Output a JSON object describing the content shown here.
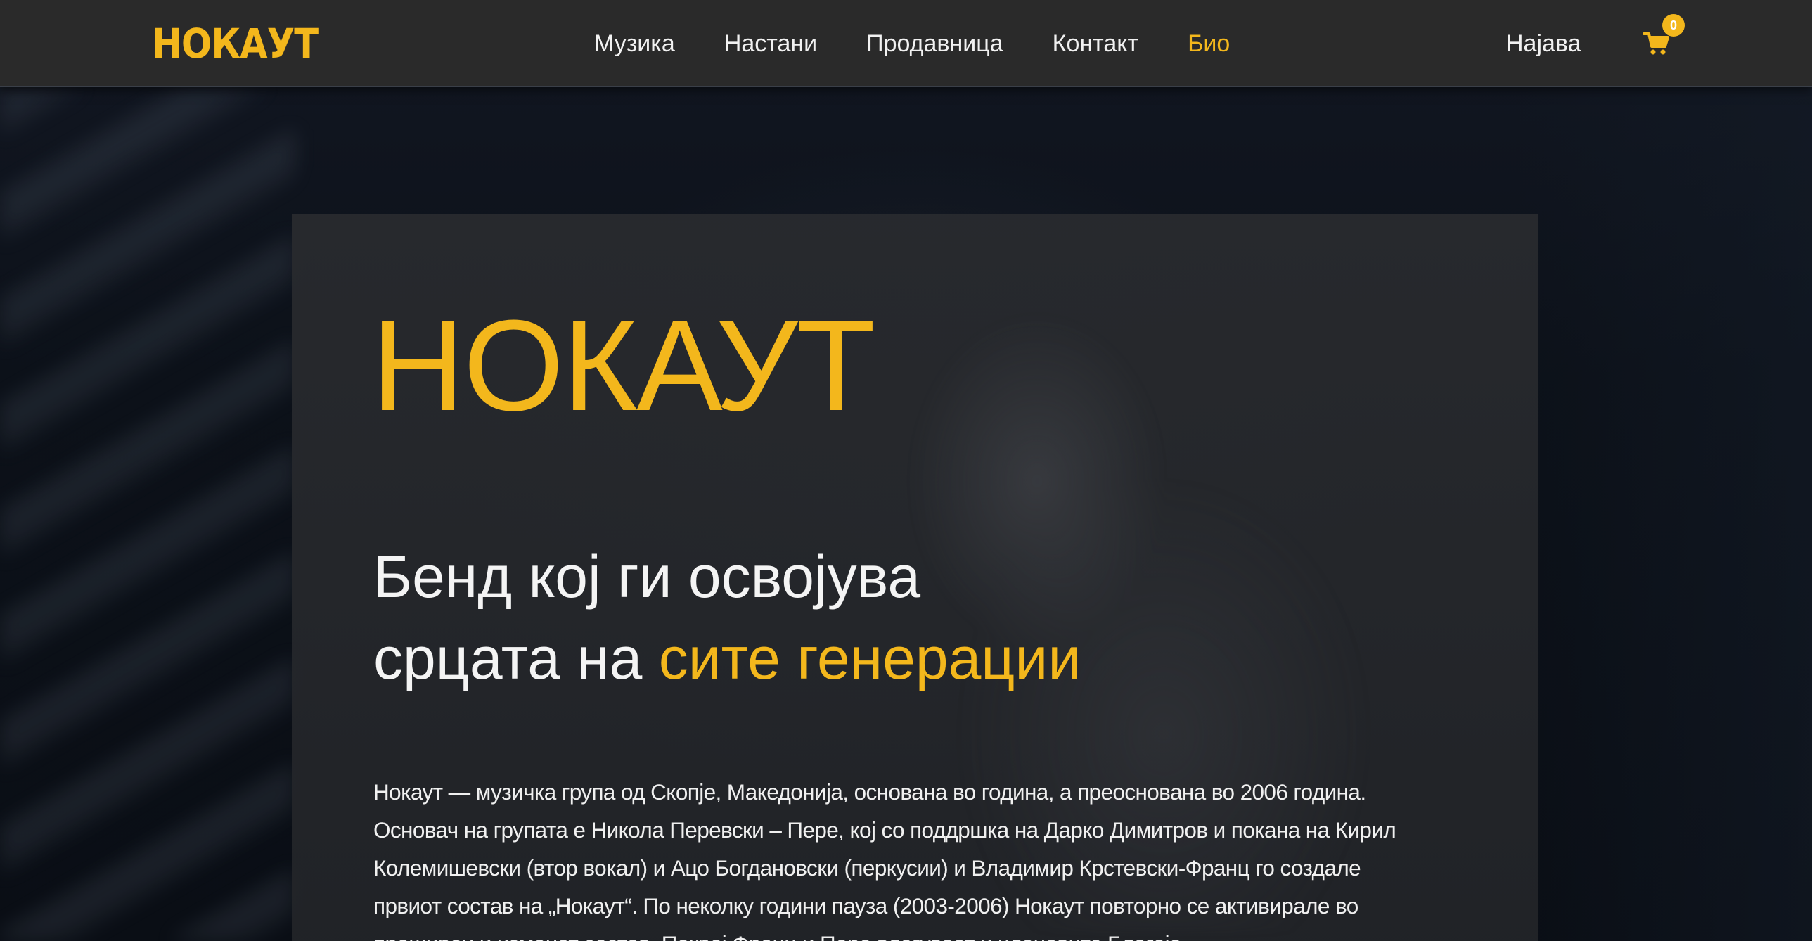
{
  "header": {
    "logo_text": "НОКАУТ",
    "nav": [
      {
        "label": "Музика"
      },
      {
        "label": "Настани"
      },
      {
        "label": "Продавница"
      },
      {
        "label": "Контакт"
      },
      {
        "label": "Био"
      }
    ],
    "active_nav": "Био",
    "login_label": "Најава",
    "cart_count": "0"
  },
  "hero": {
    "title": "НОКАУТ",
    "tagline_line1": "Бенд кој ги освојува",
    "tagline_line2_start": "срцата на ",
    "tagline_line2_accent": "сите генерации"
  },
  "bio": {
    "lines": [
      "Нокаут — музичка група од Скопје, Македонија, основана во   година, а преоснована во 2006 година.",
      "Основач на групата е Никола Перевски – Пере, кој со поддршка на Дарко Димитров и покана на Кирил",
      "Колемишевски (втор вокал) и Ацо Богдановски (перкусии) и Владимир Крстевски-Франц го создале",
      "првиот состав на „Нокаут“. По неколку години пауза (2003-2006) Нокаут повторно се активирале во",
      "проширен и изменет состав. Покрај Франц и Пере влегуваат и членовите Благоја"
    ]
  },
  "colors": {
    "accent": "#f3b71c",
    "header_bg": "#2a2a2a",
    "card_bg": "#282a2e",
    "text": "#f1f1f1"
  },
  "icons": {
    "cart": "shopping-cart-icon"
  }
}
